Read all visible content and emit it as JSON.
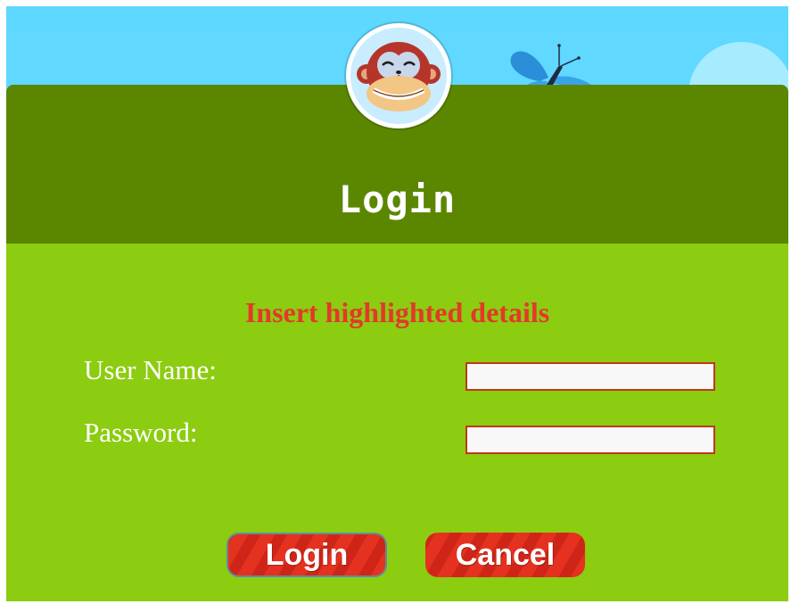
{
  "header": {
    "title": "Login"
  },
  "form": {
    "notice": "Insert highlighted details",
    "username_label": "User Name:",
    "username_value": "",
    "password_label": "Password:",
    "password_value": ""
  },
  "buttons": {
    "login_label": "Login",
    "cancel_label": "Cancel"
  },
  "icons": {
    "avatar": "monkey-avatar-icon",
    "butterfly": "butterfly-icon"
  },
  "colors": {
    "sky": "#5fd8ff",
    "header_green": "#5b8700",
    "body_green": "#8ccc11",
    "notice_red": "#e3392b",
    "button_red": "#e5311f"
  }
}
